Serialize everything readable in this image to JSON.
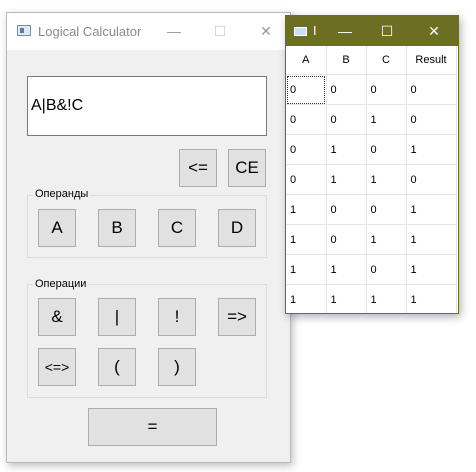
{
  "calculator": {
    "title": "Logical Calculator",
    "controls": {
      "minimize": "—",
      "maximize": "☐",
      "close": "✕"
    },
    "display_value": "A|B&!C",
    "backspace_label": "<=",
    "clear_label": "CE",
    "operands_label": "Операнды",
    "operands": [
      "A",
      "B",
      "C",
      "D"
    ],
    "operations_label": "Операции",
    "operations": [
      "&",
      "|",
      "!",
      "=>",
      "<=>",
      "(",
      ")"
    ],
    "equals_label": "="
  },
  "truth_table": {
    "title": "I",
    "controls": {
      "minimize": "—",
      "maximize": "☐",
      "close": "✕"
    },
    "columns": [
      "A",
      "B",
      "C",
      "Result"
    ],
    "rows": [
      [
        "0",
        "0",
        "0",
        "0"
      ],
      [
        "0",
        "0",
        "1",
        "0"
      ],
      [
        "0",
        "1",
        "0",
        "1"
      ],
      [
        "0",
        "1",
        "1",
        "0"
      ],
      [
        "1",
        "0",
        "0",
        "1"
      ],
      [
        "1",
        "0",
        "1",
        "1"
      ],
      [
        "1",
        "1",
        "0",
        "1"
      ],
      [
        "1",
        "1",
        "1",
        "1"
      ]
    ]
  }
}
